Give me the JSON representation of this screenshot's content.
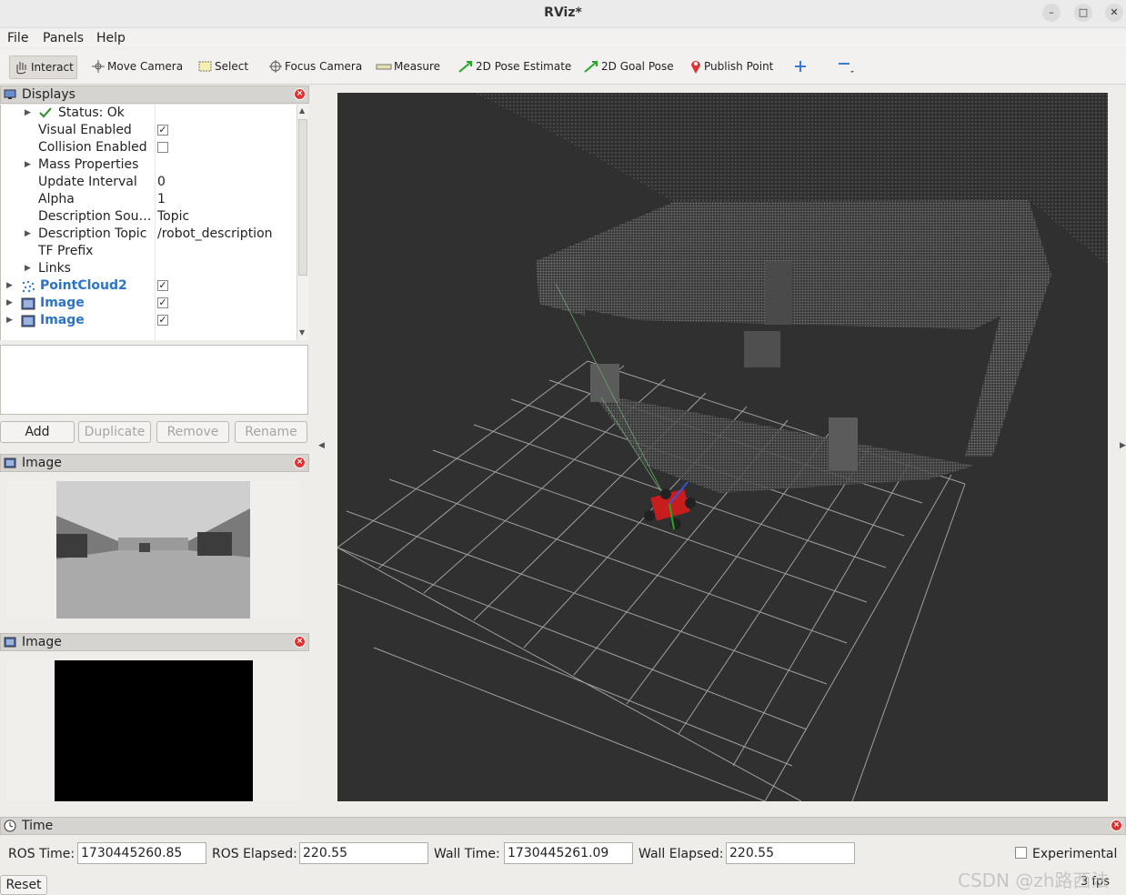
{
  "window": {
    "title": "RViz*"
  },
  "menu": [
    {
      "label": "File"
    },
    {
      "label": "Panels"
    },
    {
      "label": "Help"
    }
  ],
  "toolbar": [
    {
      "label": "Interact",
      "icon": "hand-icon"
    },
    {
      "label": "Move Camera",
      "icon": "move-camera-icon"
    },
    {
      "label": "Select",
      "icon": "select-icon"
    },
    {
      "label": "Focus Camera",
      "icon": "focus-camera-icon"
    },
    {
      "label": "Measure",
      "icon": "ruler-icon"
    },
    {
      "label": "2D Pose Estimate",
      "icon": "green-arrow-icon"
    },
    {
      "label": "2D Goal Pose",
      "icon": "green-arrow-icon"
    },
    {
      "label": "Publish Point",
      "icon": "map-pin-icon"
    }
  ],
  "displays": {
    "title": "Displays",
    "rows": [
      {
        "label": "Status: Ok",
        "value": ""
      },
      {
        "label": "Visual Enabled",
        "value": ""
      },
      {
        "label": "Collision Enabled",
        "value": ""
      },
      {
        "label": "Mass Properties",
        "value": ""
      },
      {
        "label": "Update Interval",
        "value": "0"
      },
      {
        "label": "Alpha",
        "value": "1"
      },
      {
        "label": "Description Sou…",
        "value": "Topic"
      },
      {
        "label": "Description Topic",
        "value": "/robot_description"
      },
      {
        "label": "TF Prefix",
        "value": ""
      },
      {
        "label": "Links",
        "value": ""
      },
      {
        "label": "PointCloud2",
        "value": ""
      },
      {
        "label": "Image",
        "value": ""
      },
      {
        "label": "Image",
        "value": ""
      }
    ],
    "buttons": {
      "add": "Add",
      "duplicate": "Duplicate",
      "remove": "Remove",
      "rename": "Rename"
    }
  },
  "image_panel_1": {
    "title": "Image"
  },
  "image_panel_2": {
    "title": "Image"
  },
  "time_panel": {
    "title": "Time",
    "ros_time_label": "ROS Time:",
    "ros_time": "1730445260.85",
    "ros_elapsed_label": "ROS Elapsed:",
    "ros_elapsed": "220.55",
    "wall_time_label": "Wall Time:",
    "wall_time": "1730445261.09",
    "wall_elapsed_label": "Wall Elapsed:",
    "wall_elapsed": "220.55",
    "experimental_label": "Experimental",
    "reset_label": "Reset",
    "fps": "3 fps"
  },
  "watermark": "CSDN @zh路西法",
  "colors": {
    "accent": "#2a74c9",
    "viewport_bg": "#303030",
    "close_red": "#dd3333"
  }
}
